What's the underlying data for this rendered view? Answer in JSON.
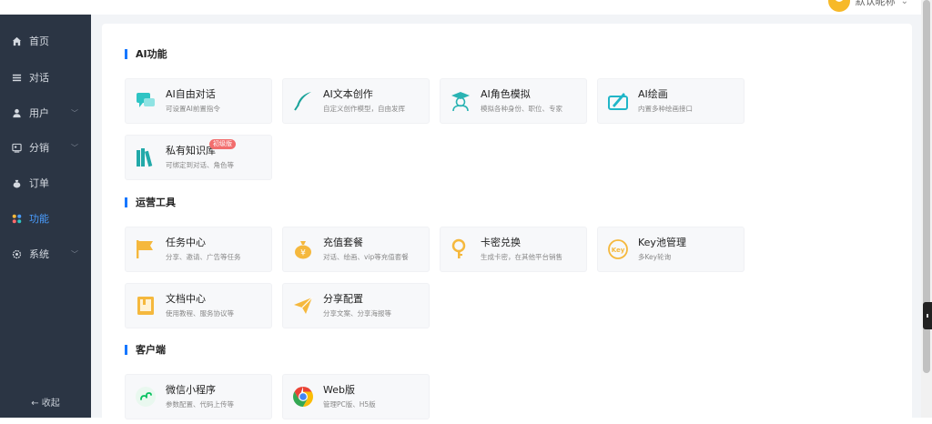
{
  "header": {
    "user_name": "默认昵称"
  },
  "sidebar": {
    "items": [
      {
        "label": "首页",
        "icon": "home-icon",
        "has_caret": false
      },
      {
        "label": "对话",
        "icon": "list-icon",
        "has_caret": false
      },
      {
        "label": "用户",
        "icon": "user-icon",
        "has_caret": true
      },
      {
        "label": "分销",
        "icon": "share-icon",
        "has_caret": true
      },
      {
        "label": "订单",
        "icon": "bag-icon",
        "has_caret": false
      },
      {
        "label": "功能",
        "icon": "apps-icon",
        "has_caret": false,
        "active": true
      },
      {
        "label": "系统",
        "icon": "gear-icon",
        "has_caret": true
      }
    ],
    "collapse_label": "← 收起"
  },
  "sections": [
    {
      "title": "AI功能",
      "cards": [
        {
          "title": "AI自由对话",
          "sub": "可设置AI前置指令",
          "icon": "chat-icon",
          "color": "#2ec4c4"
        },
        {
          "title": "AI文本创作",
          "sub": "自定义创作模型，自由发挥",
          "icon": "feather-icon",
          "color": "#1aa39a"
        },
        {
          "title": "AI角色模拟",
          "sub": "模拟各种身份、职位、专家",
          "icon": "graduate-icon",
          "color": "#2ab3b3"
        },
        {
          "title": "AI绘画",
          "sub": "内置多种绘画接口",
          "icon": "paint-icon",
          "color": "#20b6c8"
        },
        {
          "title": "私有知识库",
          "sub": "可绑定到对话、角色等",
          "icon": "books-icon",
          "color": "#22a9a9",
          "badge": "初级版"
        }
      ]
    },
    {
      "title": "运营工具",
      "cards": [
        {
          "title": "任务中心",
          "sub": "分享、邀请、广告等任务",
          "icon": "flag-icon",
          "color": "#f5b83d"
        },
        {
          "title": "充值套餐",
          "sub": "对话、绘画、vip等充值套餐",
          "icon": "moneybag-icon",
          "color": "#f5b83d"
        },
        {
          "title": "卡密兑换",
          "sub": "生成卡密，在其他平台销售",
          "icon": "key-icon",
          "color": "#f5b83d"
        },
        {
          "title": "Key池管理",
          "sub": "多Key轮询",
          "icon": "key-badge-icon",
          "color": "#f5b83d"
        },
        {
          "title": "文档中心",
          "sub": "使用教程、服务协议等",
          "icon": "document-icon",
          "color": "#f5b83d"
        },
        {
          "title": "分享配置",
          "sub": "分享文案、分享海报等",
          "icon": "paper-plane-icon",
          "color": "#f5b83d"
        }
      ]
    },
    {
      "title": "客户端",
      "cards": [
        {
          "title": "微信小程序",
          "sub": "参数配置、代码上传等",
          "icon": "mini-program-icon",
          "color": "#07c160"
        },
        {
          "title": "Web版",
          "sub": "管理PC版、H5版",
          "icon": "chrome-icon",
          "color": "#4285f4"
        }
      ]
    }
  ]
}
